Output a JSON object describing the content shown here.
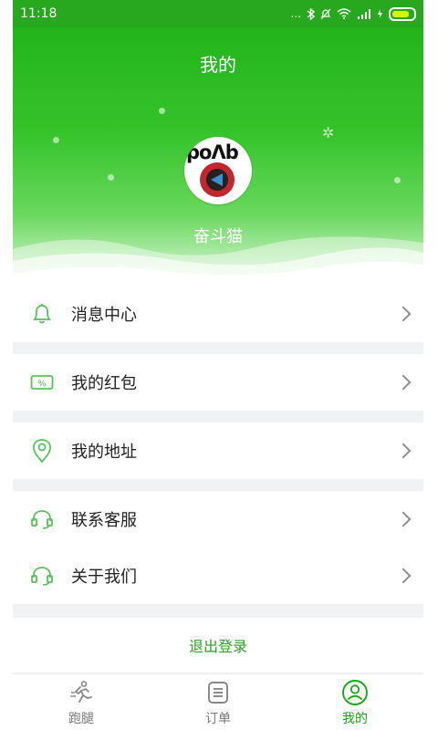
{
  "status_bar": {
    "time": "11:18",
    "indicator_text": "..."
  },
  "header": {
    "title": "我的"
  },
  "profile": {
    "avatar_text": "pοΛb",
    "name": "奋斗猫"
  },
  "menu": {
    "notifications": "消息中心",
    "red_packets": "我的红包",
    "addresses": "我的地址",
    "contact_support": "联系客服",
    "about_us": "关于我们"
  },
  "logout_label": "退出登录",
  "tabs": {
    "errand": "跑腿",
    "orders": "订单",
    "mine": "我的"
  },
  "colors": {
    "brand_green": "#28a81f",
    "active_tab": "#17a814",
    "icon_green": "#59c15a"
  }
}
